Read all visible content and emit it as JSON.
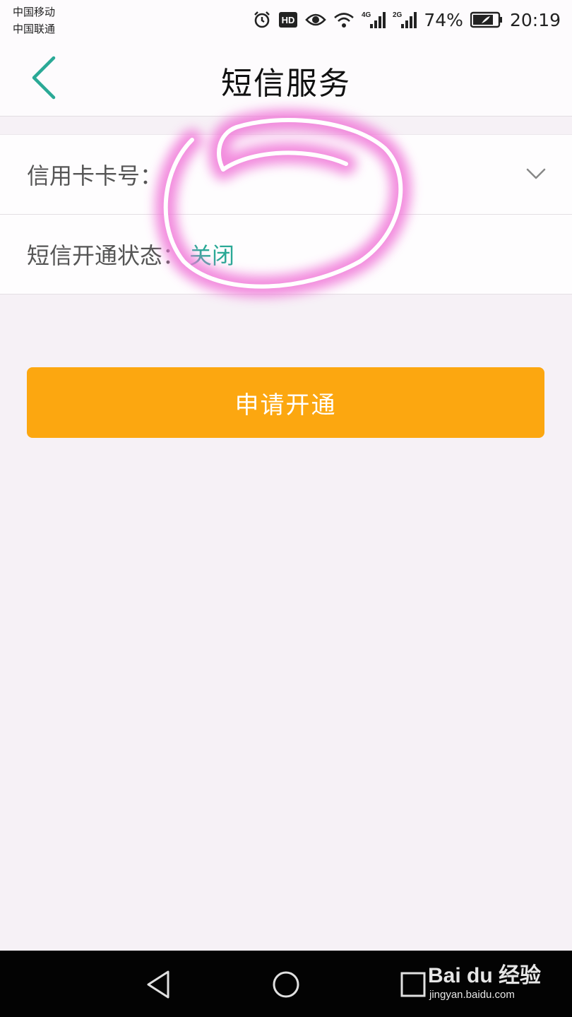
{
  "status_bar": {
    "carrier_1": "中国移动",
    "carrier_2": "中国联通",
    "network_1": "4G",
    "network_2": "2G",
    "battery": "74%",
    "time": "20:19",
    "icons": [
      "alarm-icon",
      "hd-icon",
      "eye-icon",
      "wifi-icon",
      "signal-icon",
      "battery-icon"
    ]
  },
  "header": {
    "title": "短信服务",
    "back_icon": "chevron-left-icon",
    "accent_color": "#2aa996"
  },
  "form": {
    "card_label": "信用卡卡号：",
    "card_value": "",
    "status_label": "短信开通状态：",
    "status_value": "关闭"
  },
  "actions": {
    "apply_label": "申请开通",
    "apply_color": "#fca710"
  },
  "watermark": {
    "logo": "Bai du 经验",
    "url": "jingyan.baidu.com"
  }
}
